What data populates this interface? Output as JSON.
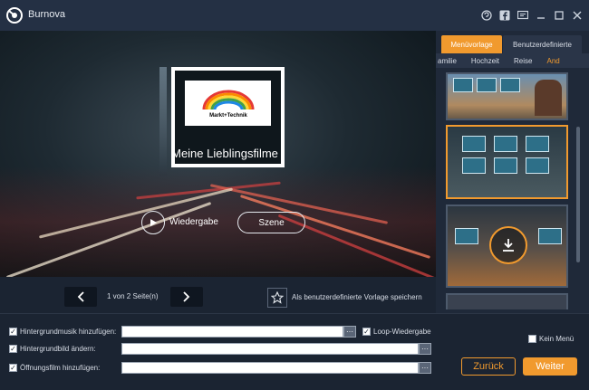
{
  "app": {
    "title": "Burnova"
  },
  "titlebar": {
    "icons": [
      "support-icon",
      "facebook-icon",
      "feedback-icon",
      "minimize-icon",
      "maximize-icon",
      "close-icon"
    ]
  },
  "preview": {
    "logo_text": "Markt+Technik",
    "disc_title": "Meine Lieblingsfilme",
    "play_label": "Wiedergabe",
    "scene_label": "Szene"
  },
  "pagenav": {
    "page_info": "1 von 2 Seite(n)",
    "save_template_label": "Als benutzerdefinierte Vorlage speichern"
  },
  "rpanel": {
    "tabs": [
      {
        "label": "Menüvorlage"
      },
      {
        "label": "Benutzerdefinierte"
      }
    ],
    "categories": [
      {
        "label": "amilie"
      },
      {
        "label": "Hochzeit"
      },
      {
        "label": "Reise"
      },
      {
        "label": "And"
      }
    ]
  },
  "bottom": {
    "music_label": "Hintergrundmusik hinzufügen:",
    "loop_label": "Loop-Wiedergabe",
    "bg_label": "Hintergrundbild ändern:",
    "opening_label": "Öffnungsfilm hinzufügen:",
    "no_menu_label": "Kein Menü",
    "ellipsis": "···",
    "back_label": "Zurück",
    "next_label": "Weiter"
  },
  "colors": {
    "accent": "#f19a2e",
    "background": "#1b2432",
    "titlebar": "#243044"
  }
}
